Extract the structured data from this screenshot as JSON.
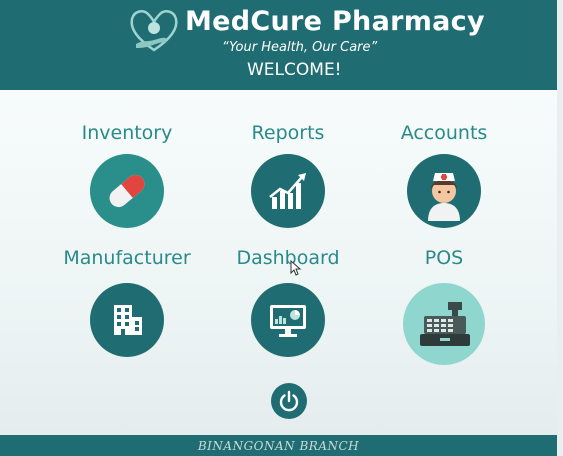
{
  "header": {
    "title": "MedCure Pharmacy",
    "tagline": "“Your Health, Our Care”",
    "welcome": "WELCOME!"
  },
  "tiles": [
    {
      "label": "Inventory",
      "icon": "pill-capsule-icon"
    },
    {
      "label": "Reports",
      "icon": "bar-chart-growth-icon"
    },
    {
      "label": "Accounts",
      "icon": "nurse-avatar-icon"
    },
    {
      "label": "Manufacturer",
      "icon": "building-icon"
    },
    {
      "label": "Dashboard",
      "icon": "monitor-dashboard-icon"
    },
    {
      "label": "POS",
      "icon": "cash-register-icon"
    }
  ],
  "power": {
    "icon": "power-icon"
  },
  "footer": {
    "branch": "BINANGONAN BRANCH"
  },
  "colors": {
    "brand": "#1f6d72",
    "label": "#2a8a8a",
    "tile_bg": "#2a8f8a",
    "pos_bg": "#8fd6cf"
  }
}
